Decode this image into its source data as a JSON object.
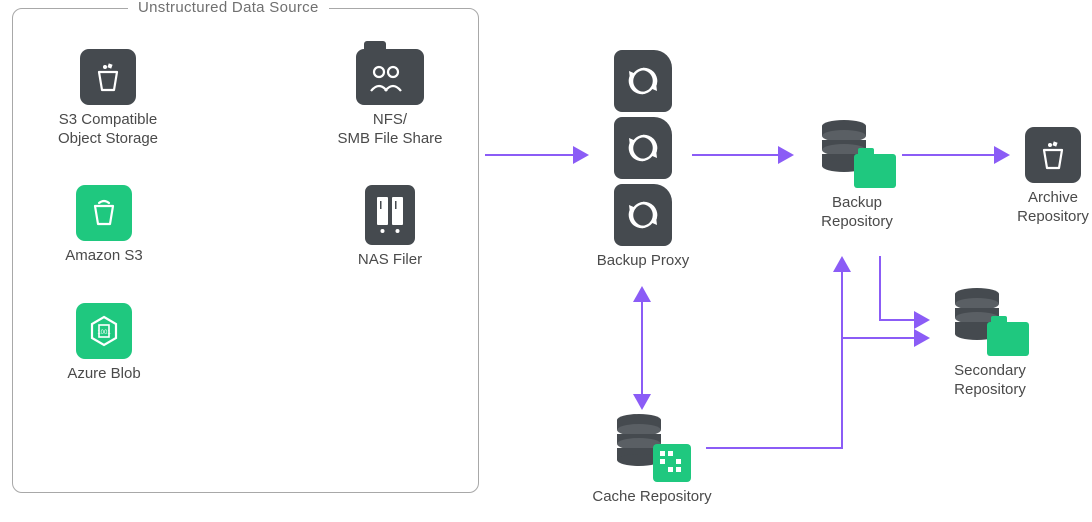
{
  "group_title": "Unstructured Data Source",
  "nodes": {
    "s3compat": {
      "label": "S3 Compatible\nObject Storage"
    },
    "amazon_s3": {
      "label": "Amazon S3"
    },
    "azure_blob": {
      "label": "Azure Blob"
    },
    "nfs_smb": {
      "label": "NFS/\nSMB File Share"
    },
    "nas_filer": {
      "label": "NAS Filer"
    },
    "backup_proxy": {
      "label": "Backup Proxy"
    },
    "backup_repo": {
      "label": "Backup\nRepository"
    },
    "archive_repo": {
      "label": "Archive\nRepository"
    },
    "secondary_repo": {
      "label": "Secondary\nRepository"
    },
    "cache_repo": {
      "label": "Cache Repository"
    }
  },
  "colors": {
    "dark": "#454a4f",
    "green": "#1fc87f",
    "arrow": "#8b5cf6"
  }
}
